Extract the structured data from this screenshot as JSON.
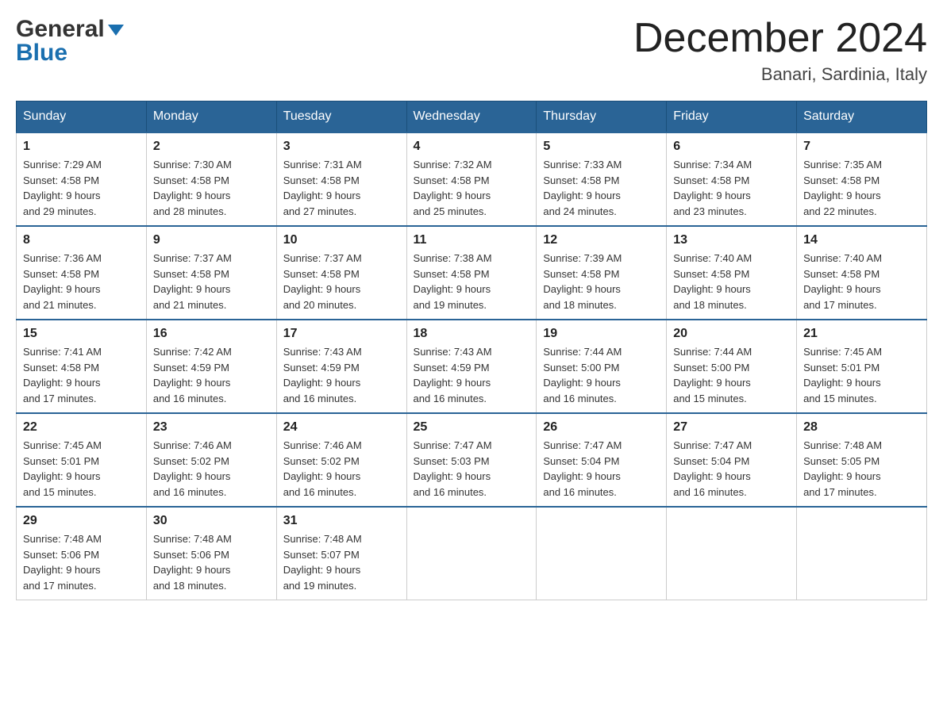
{
  "header": {
    "logo_line1": "General",
    "logo_line2": "Blue",
    "month_title": "December 2024",
    "location": "Banari, Sardinia, Italy"
  },
  "days_of_week": [
    "Sunday",
    "Monday",
    "Tuesday",
    "Wednesday",
    "Thursday",
    "Friday",
    "Saturday"
  ],
  "weeks": [
    [
      {
        "day": "1",
        "sunrise": "7:29 AM",
        "sunset": "4:58 PM",
        "daylight": "9 hours and 29 minutes."
      },
      {
        "day": "2",
        "sunrise": "7:30 AM",
        "sunset": "4:58 PM",
        "daylight": "9 hours and 28 minutes."
      },
      {
        "day": "3",
        "sunrise": "7:31 AM",
        "sunset": "4:58 PM",
        "daylight": "9 hours and 27 minutes."
      },
      {
        "day": "4",
        "sunrise": "7:32 AM",
        "sunset": "4:58 PM",
        "daylight": "9 hours and 25 minutes."
      },
      {
        "day": "5",
        "sunrise": "7:33 AM",
        "sunset": "4:58 PM",
        "daylight": "9 hours and 24 minutes."
      },
      {
        "day": "6",
        "sunrise": "7:34 AM",
        "sunset": "4:58 PM",
        "daylight": "9 hours and 23 minutes."
      },
      {
        "day": "7",
        "sunrise": "7:35 AM",
        "sunset": "4:58 PM",
        "daylight": "9 hours and 22 minutes."
      }
    ],
    [
      {
        "day": "8",
        "sunrise": "7:36 AM",
        "sunset": "4:58 PM",
        "daylight": "9 hours and 21 minutes."
      },
      {
        "day": "9",
        "sunrise": "7:37 AM",
        "sunset": "4:58 PM",
        "daylight": "9 hours and 21 minutes."
      },
      {
        "day": "10",
        "sunrise": "7:37 AM",
        "sunset": "4:58 PM",
        "daylight": "9 hours and 20 minutes."
      },
      {
        "day": "11",
        "sunrise": "7:38 AM",
        "sunset": "4:58 PM",
        "daylight": "9 hours and 19 minutes."
      },
      {
        "day": "12",
        "sunrise": "7:39 AM",
        "sunset": "4:58 PM",
        "daylight": "9 hours and 18 minutes."
      },
      {
        "day": "13",
        "sunrise": "7:40 AM",
        "sunset": "4:58 PM",
        "daylight": "9 hours and 18 minutes."
      },
      {
        "day": "14",
        "sunrise": "7:40 AM",
        "sunset": "4:58 PM",
        "daylight": "9 hours and 17 minutes."
      }
    ],
    [
      {
        "day": "15",
        "sunrise": "7:41 AM",
        "sunset": "4:58 PM",
        "daylight": "9 hours and 17 minutes."
      },
      {
        "day": "16",
        "sunrise": "7:42 AM",
        "sunset": "4:59 PM",
        "daylight": "9 hours and 16 minutes."
      },
      {
        "day": "17",
        "sunrise": "7:43 AM",
        "sunset": "4:59 PM",
        "daylight": "9 hours and 16 minutes."
      },
      {
        "day": "18",
        "sunrise": "7:43 AM",
        "sunset": "4:59 PM",
        "daylight": "9 hours and 16 minutes."
      },
      {
        "day": "19",
        "sunrise": "7:44 AM",
        "sunset": "5:00 PM",
        "daylight": "9 hours and 16 minutes."
      },
      {
        "day": "20",
        "sunrise": "7:44 AM",
        "sunset": "5:00 PM",
        "daylight": "9 hours and 15 minutes."
      },
      {
        "day": "21",
        "sunrise": "7:45 AM",
        "sunset": "5:01 PM",
        "daylight": "9 hours and 15 minutes."
      }
    ],
    [
      {
        "day": "22",
        "sunrise": "7:45 AM",
        "sunset": "5:01 PM",
        "daylight": "9 hours and 15 minutes."
      },
      {
        "day": "23",
        "sunrise": "7:46 AM",
        "sunset": "5:02 PM",
        "daylight": "9 hours and 16 minutes."
      },
      {
        "day": "24",
        "sunrise": "7:46 AM",
        "sunset": "5:02 PM",
        "daylight": "9 hours and 16 minutes."
      },
      {
        "day": "25",
        "sunrise": "7:47 AM",
        "sunset": "5:03 PM",
        "daylight": "9 hours and 16 minutes."
      },
      {
        "day": "26",
        "sunrise": "7:47 AM",
        "sunset": "5:04 PM",
        "daylight": "9 hours and 16 minutes."
      },
      {
        "day": "27",
        "sunrise": "7:47 AM",
        "sunset": "5:04 PM",
        "daylight": "9 hours and 16 minutes."
      },
      {
        "day": "28",
        "sunrise": "7:48 AM",
        "sunset": "5:05 PM",
        "daylight": "9 hours and 17 minutes."
      }
    ],
    [
      {
        "day": "29",
        "sunrise": "7:48 AM",
        "sunset": "5:06 PM",
        "daylight": "9 hours and 17 minutes."
      },
      {
        "day": "30",
        "sunrise": "7:48 AM",
        "sunset": "5:06 PM",
        "daylight": "9 hours and 18 minutes."
      },
      {
        "day": "31",
        "sunrise": "7:48 AM",
        "sunset": "5:07 PM",
        "daylight": "9 hours and 19 minutes."
      },
      null,
      null,
      null,
      null
    ]
  ],
  "labels": {
    "sunrise": "Sunrise:",
    "sunset": "Sunset:",
    "daylight": "Daylight:"
  }
}
